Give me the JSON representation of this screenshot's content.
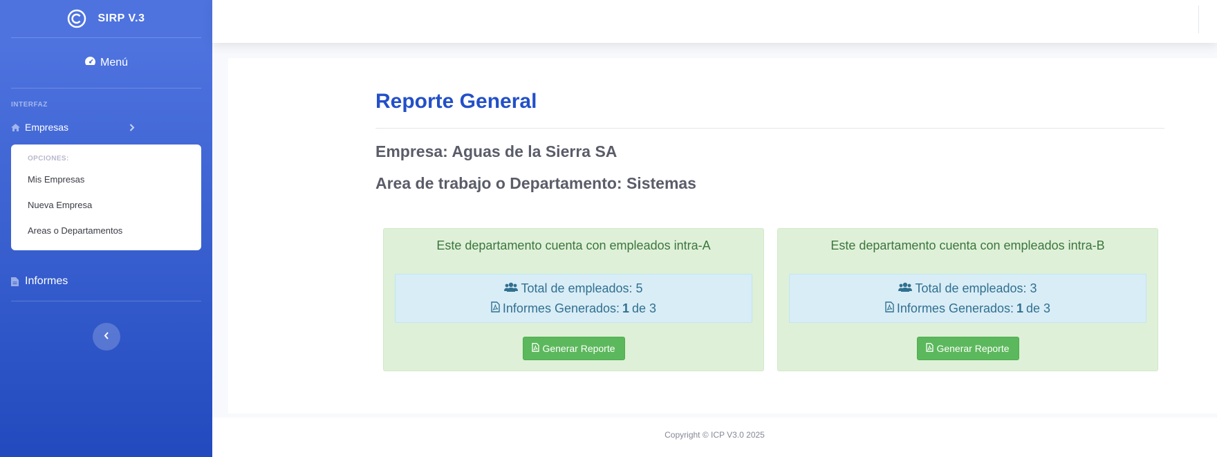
{
  "sidebar": {
    "brand": "SIRP V.3",
    "menu_label": "Menú",
    "section_heading": "INTERFAZ",
    "empresas_label": "Empresas",
    "collapse": {
      "header": "OPCIONES:",
      "items": [
        {
          "label": "Mis Empresas"
        },
        {
          "label": "Nueva Empresa"
        },
        {
          "label": "Areas o Departamentos"
        }
      ]
    },
    "informes_label": "Informes"
  },
  "main": {
    "title": "Reporte General",
    "empresa_heading": "Empresa: Aguas de la Sierra SA",
    "area_heading": "Area de trabajo o Departamento: Sistemas",
    "departments": [
      {
        "title": "Este departamento cuenta con empleados intra-A",
        "total_label": "Total de empleados: 5",
        "informes_prefix": "Informes Generados:",
        "informes_count": "1",
        "informes_suffix": "de 3",
        "button_label": "Generar Reporte"
      },
      {
        "title": "Este departamento cuenta con empleados intra-B",
        "total_label": "Total de empleados: 3",
        "informes_prefix": "Informes Generados:",
        "informes_count": "1",
        "informes_suffix": "de 3",
        "button_label": "Generar Reporte"
      }
    ]
  },
  "footer": {
    "copyright": "Copyright © ICP V3.0 2025"
  },
  "icons": {
    "brand": "copyright-icon",
    "menu": "tachometer-icon",
    "empresas": "home-icon",
    "informes": "file-text-icon",
    "employees": "users-icon",
    "pdf": "file-pdf-icon"
  },
  "colors": {
    "sidebar_top": "#4e73df",
    "sidebar_bottom": "#224abe",
    "title": "#2350c9",
    "success_bg": "#dff0d8",
    "info_bg": "#d9edf7",
    "button": "#5cb85c"
  }
}
